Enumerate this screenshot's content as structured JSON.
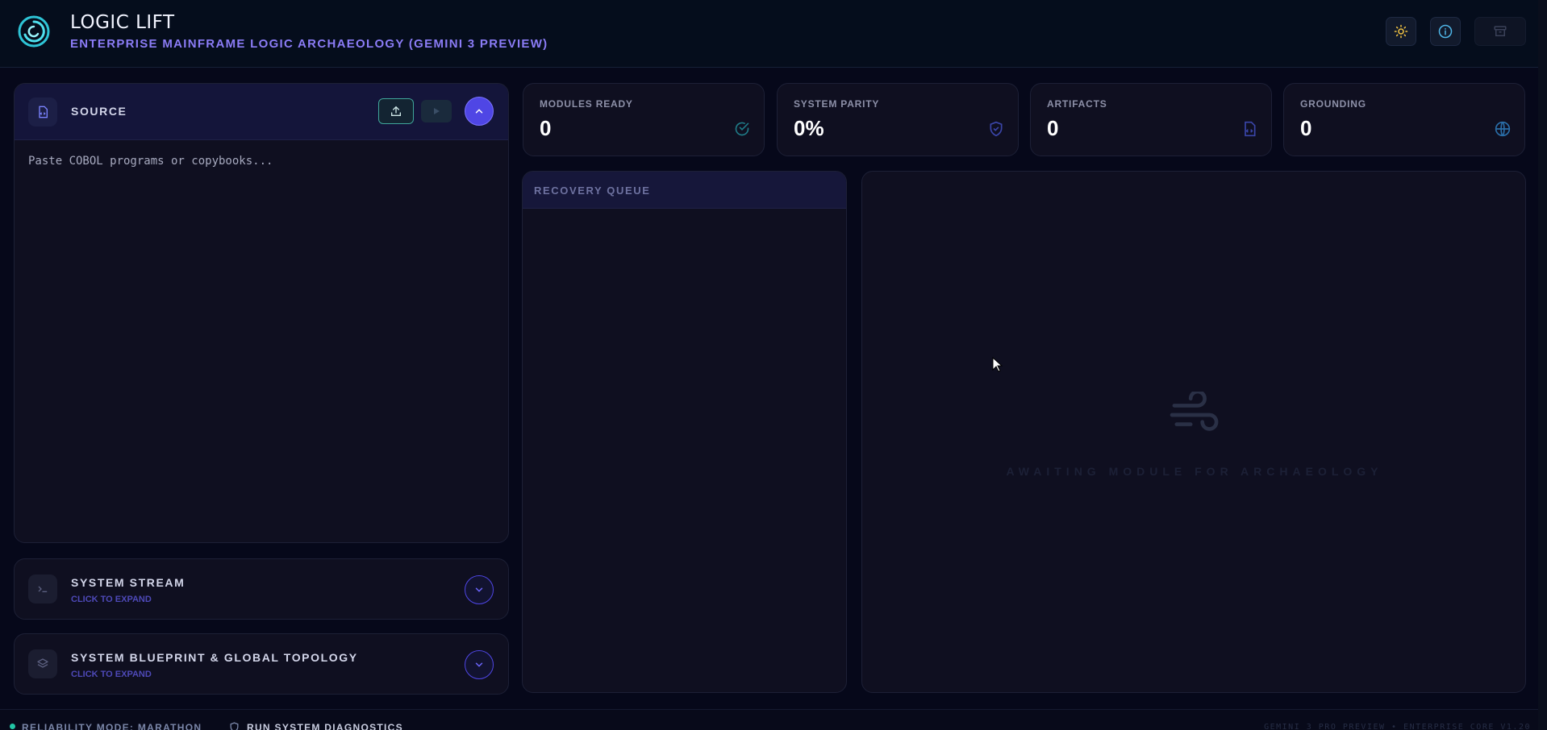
{
  "header": {
    "title": "LOGIC LIFT",
    "subtitle": "ENTERPRISE MAINFRAME LOGIC ARCHAEOLOGY (GEMINI 3 PREVIEW)",
    "theme_icon": "sun-icon",
    "info_icon": "info-icon",
    "archive_icon": "archive-icon"
  },
  "source": {
    "title": "SOURCE",
    "placeholder": "Paste COBOL programs or copybooks...",
    "icon": "file-code-icon"
  },
  "system_stream": {
    "title": "SYSTEM STREAM",
    "subtitle": "CLICK TO EXPAND",
    "icon": "terminal-icon"
  },
  "blueprint": {
    "title": "SYSTEM BLUEPRINT & GLOBAL TOPOLOGY",
    "subtitle": "CLICK TO EXPAND",
    "icon": "layers-icon"
  },
  "stats": [
    {
      "label": "MODULES READY",
      "value": "0",
      "icon": "check-circle-icon"
    },
    {
      "label": "SYSTEM PARITY",
      "value": "0%",
      "icon": "shield-check-icon"
    },
    {
      "label": "ARTIFACTS",
      "value": "0",
      "icon": "file-icon"
    },
    {
      "label": "GROUNDING",
      "value": "0",
      "icon": "globe-icon"
    }
  ],
  "queue": {
    "title": "RECOVERY QUEUE"
  },
  "main": {
    "empty_text": "AWAITING MODULE FOR ARCHAEOLOGY",
    "empty_icon": "wind-icon"
  },
  "footer": {
    "mode": "RELIABILITY MODE: MARATHON",
    "diagnostics": "RUN SYSTEM DIAGNOSTICS",
    "version": "GEMINI 3 PRO PREVIEW • ENTERPRISE CORE V1.20"
  },
  "colors": {
    "accent": "#4f46e5",
    "teal": "#22c5a5",
    "subtitle": "#8b7cf6"
  }
}
